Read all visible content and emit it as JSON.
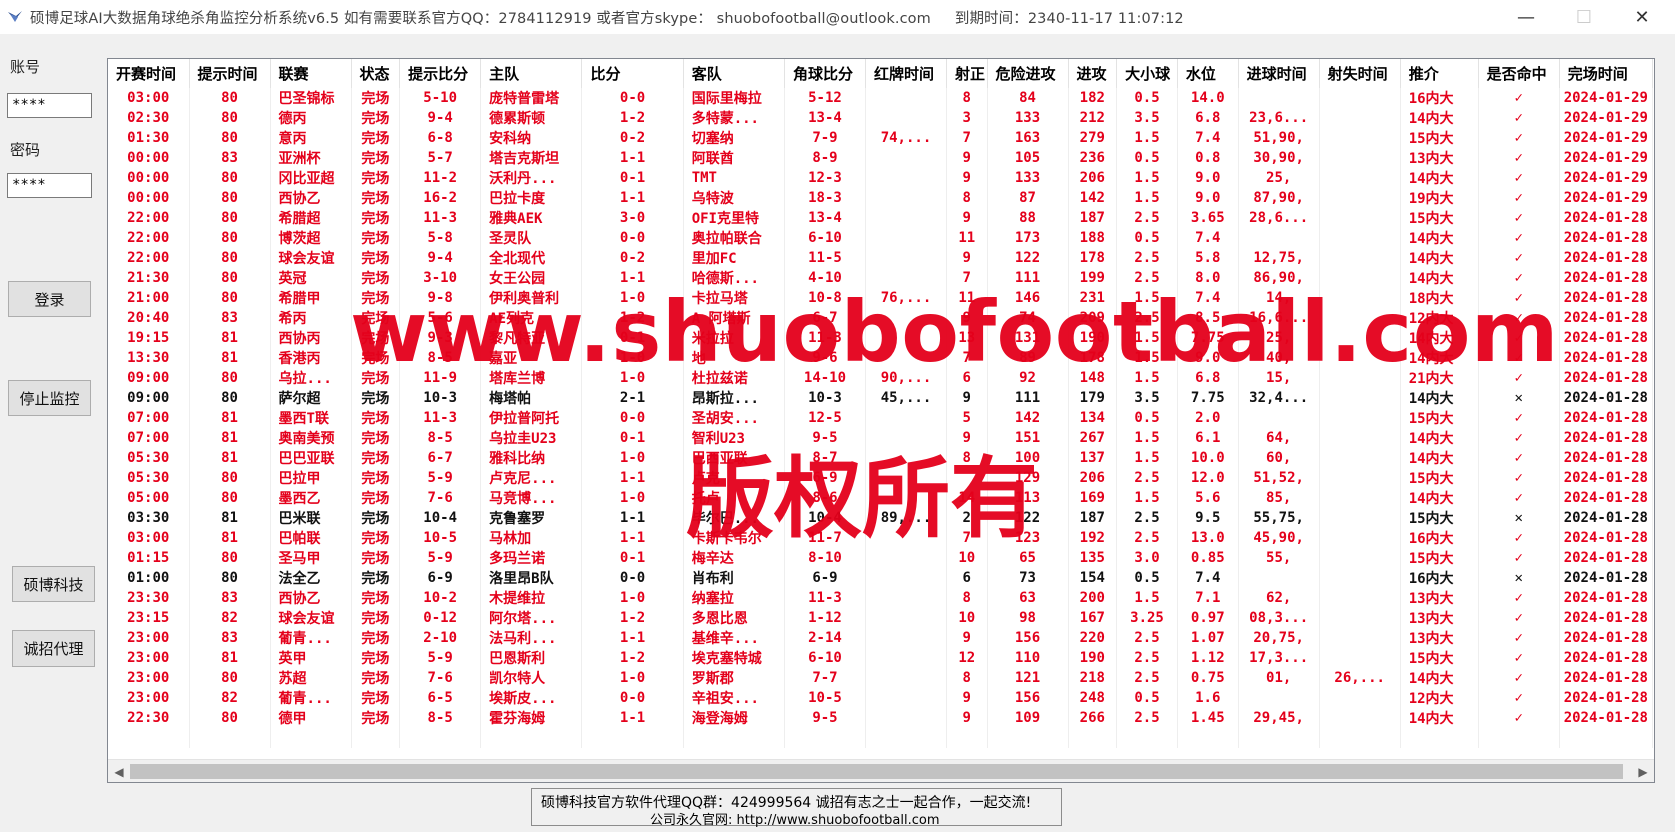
{
  "window": {
    "title": "硕博足球AI大数据角球绝杀角监控分析系统v6.5  如有需要联系官方QQ：2784112919 或者官方skype：  shuobofootball@outlook.com",
    "expire": "到期时间：2340-11-17 11:07:12",
    "minimize_glyph": "—",
    "maximize_glyph": "☐",
    "close_glyph": "✕"
  },
  "sidebar": {
    "account_label": "账号",
    "account_value": "****",
    "password_label": "密码",
    "password_value": "****",
    "login_button": "登录",
    "stop_button": "停止监控",
    "company_button": "硕博科技",
    "agent_button": "诚招代理"
  },
  "table": {
    "headers": [
      "开赛时间",
      "提示时间",
      "联赛",
      "状态",
      "提示比分",
      "主队",
      "比分",
      "客队",
      "角球比分",
      "红牌时间",
      "射正",
      "危险进攻",
      "进攻",
      "大小球",
      "水位",
      "进球时间",
      "射失时间",
      "推介",
      "是否命中",
      "完场时间"
    ],
    "rows": [
      {
        "c": [
          "03:00",
          "80",
          "巴圣锦标",
          "完场",
          "5-10",
          "庞特普雷塔",
          "0-0",
          "国际里梅拉",
          "5-12",
          "",
          "8",
          "84",
          "182",
          "0.5",
          "14.0",
          "",
          "",
          "16内大",
          "✓",
          "2024-01-29"
        ],
        "color": "red"
      },
      {
        "c": [
          "02:30",
          "80",
          "德丙",
          "完场",
          "9-4",
          "德累斯顿",
          "1-2",
          "多特蒙...",
          "13-4",
          "",
          "3",
          "133",
          "212",
          "3.5",
          "6.8",
          "23,6...",
          "",
          "14内大",
          "✓",
          "2024-01-29"
        ],
        "color": "red"
      },
      {
        "c": [
          "01:30",
          "80",
          "意丙",
          "完场",
          "6-8",
          "安科纳",
          "0-2",
          "切塞纳",
          "7-9",
          "74,...",
          "7",
          "163",
          "279",
          "1.5",
          "7.4",
          "51,90,",
          "",
          "15内大",
          "✓",
          "2024-01-29"
        ],
        "color": "red"
      },
      {
        "c": [
          "00:00",
          "83",
          "亚洲杯",
          "完场",
          "5-7",
          "塔吉克斯坦",
          "1-1",
          "阿联酋",
          "8-9",
          "",
          "9",
          "105",
          "236",
          "0.5",
          "0.8",
          "30,90,",
          "",
          "13内大",
          "✓",
          "2024-01-29"
        ],
        "color": "red"
      },
      {
        "c": [
          "00:00",
          "80",
          "冈比亚超",
          "完场",
          "11-2",
          "沃利丹...",
          "0-1",
          "TMT",
          "12-3",
          "",
          "9",
          "133",
          "206",
          "1.5",
          "9.0",
          "25,",
          "",
          "14内大",
          "✓",
          "2024-01-29"
        ],
        "color": "red"
      },
      {
        "c": [
          "00:00",
          "80",
          "西协乙",
          "完场",
          "16-2",
          "巴拉卡度",
          "1-1",
          "乌特波",
          "18-3",
          "",
          "8",
          "87",
          "142",
          "1.5",
          "9.0",
          "87,90,",
          "",
          "19内大",
          "✓",
          "2024-01-29"
        ],
        "color": "red"
      },
      {
        "c": [
          "22:00",
          "80",
          "希腊超",
          "完场",
          "11-3",
          "雅典AEK",
          "3-0",
          "OFI克里特",
          "13-4",
          "",
          "9",
          "88",
          "187",
          "2.5",
          "3.65",
          "28,6...",
          "",
          "15内大",
          "✓",
          "2024-01-28"
        ],
        "color": "red"
      },
      {
        "c": [
          "22:00",
          "80",
          "博茨超",
          "完场",
          "5-8",
          "圣灵队",
          "0-0",
          "奥拉帕联合",
          "6-10",
          "",
          "11",
          "173",
          "188",
          "0.5",
          "7.4",
          "",
          "",
          "14内大",
          "✓",
          "2024-01-28"
        ],
        "color": "red"
      },
      {
        "c": [
          "22:00",
          "80",
          "球会友谊",
          "完场",
          "9-4",
          "全北现代",
          "0-2",
          "里加FC",
          "11-5",
          "",
          "9",
          "122",
          "178",
          "2.5",
          "5.8",
          "12,75,",
          "",
          "14内大",
          "✓",
          "2024-01-28"
        ],
        "color": "red"
      },
      {
        "c": [
          "21:30",
          "80",
          "英冠",
          "完场",
          "3-10",
          "女王公园",
          "1-1",
          "哈德斯...",
          "4-10",
          "",
          "7",
          "111",
          "199",
          "2.5",
          "8.0",
          "86,90,",
          "",
          "14内大",
          "✓",
          "2024-01-28"
        ],
        "color": "red"
      },
      {
        "c": [
          "21:00",
          "80",
          "希腊甲",
          "完场",
          "9-8",
          "伊利奥普利",
          "1-0",
          "卡拉马塔",
          "10-8",
          "76,...",
          "11",
          "146",
          "231",
          "1.5",
          "7.4",
          "14,",
          "",
          "18内大",
          "✓",
          "2024-01-28"
        ],
        "color": "red"
      },
      {
        "c": [
          "20:40",
          "83",
          "希丙",
          "完场",
          "5-6",
          "AE列克",
          "1-2",
          "A 阿塔斯",
          "6-7",
          "",
          "9",
          "74",
          "209",
          "2.5",
          "8.5",
          "16,6...",
          "",
          "12内大",
          "✓",
          "2024-01-28"
        ],
        "color": "red"
      },
      {
        "c": [
          "19:15",
          "81",
          "西协丙",
          "完场",
          "9-3",
          "黎凡特亚",
          "0-1",
          "米拉拉",
          "11-3",
          "",
          "13",
          "131",
          "190",
          "1.5",
          "7.75",
          "25,",
          "",
          "14内大",
          "✓",
          "2024-01-28"
        ],
        "color": "red"
      },
      {
        "c": [
          "13:30",
          "81",
          "香港丙",
          "完场",
          "8-5",
          "嘉亚",
          "1-0",
          "地",
          "9-6",
          "",
          "7",
          "89",
          "178",
          "1.5",
          "9.0",
          "40,",
          "",
          "14内大",
          "✓",
          "2024-01-28"
        ],
        "color": "red"
      },
      {
        "c": [
          "09:00",
          "80",
          "乌拉...",
          "完场",
          "11-9",
          "塔库兰博",
          "1-0",
          "杜拉兹诺",
          "14-10",
          "90,...",
          "6",
          "92",
          "148",
          "1.5",
          "6.8",
          "15,",
          "",
          "21内大",
          "✓",
          "2024-01-28"
        ],
        "color": "red"
      },
      {
        "c": [
          "09:00",
          "80",
          "萨尔超",
          "完场",
          "10-3",
          "梅塔帕",
          "2-1",
          "昂斯拉...",
          "10-3",
          "45,...",
          "9",
          "111",
          "179",
          "3.5",
          "7.75",
          "32,4...",
          "",
          "14内大",
          "✕",
          "2024-01-28"
        ],
        "color": "black"
      },
      {
        "c": [
          "07:00",
          "81",
          "墨西T联",
          "完场",
          "11-3",
          "伊拉普阿托",
          "0-0",
          "圣胡安...",
          "12-5",
          "",
          "5",
          "142",
          "134",
          "0.5",
          "2.0",
          "",
          "",
          "15内大",
          "✓",
          "2024-01-28"
        ],
        "color": "red"
      },
      {
        "c": [
          "07:00",
          "81",
          "奥南美预",
          "完场",
          "8-5",
          "乌拉圭U23",
          "0-1",
          "智利U23",
          "9-5",
          "",
          "9",
          "151",
          "267",
          "1.5",
          "6.1",
          "64,",
          "",
          "14内大",
          "✓",
          "2024-01-28"
        ],
        "color": "red"
      },
      {
        "c": [
          "05:30",
          "81",
          "巴巴亚联",
          "完场",
          "6-7",
          "雅科比纳",
          "1-0",
          "巴西亚联",
          "8-7",
          "",
          "8",
          "100",
          "137",
          "1.5",
          "10.0",
          "60,",
          "",
          "14内大",
          "✓",
          "2024-01-28"
        ],
        "color": "red"
      },
      {
        "c": [
          "05:30",
          "80",
          "巴拉甲",
          "完场",
          "5-9",
          "卢克尼...",
          "1-1",
          "卢克",
          "6-9",
          "",
          "",
          "129",
          "206",
          "2.5",
          "12.0",
          "51,52,",
          "",
          "15内大",
          "✓",
          "2024-01-28"
        ],
        "color": "red"
      },
      {
        "c": [
          "05:00",
          "80",
          "墨西乙",
          "完场",
          "7-6",
          "马竞博...",
          "1-0",
          "托卢",
          "8-6",
          "",
          "14",
          "113",
          "169",
          "1.5",
          "5.6",
          "85,",
          "",
          "14内大",
          "✓",
          "2024-01-28"
        ],
        "color": "red"
      },
      {
        "c": [
          "03:30",
          "81",
          "巴米联",
          "完场",
          "10-4",
          "克鲁塞罗",
          "1-1",
          "毕尔巴...",
          "10-4",
          "89,...",
          "2",
          "122",
          "187",
          "2.5",
          "9.5",
          "55,75,",
          "",
          "15内大",
          "✕",
          "2024-01-28"
        ],
        "color": "black"
      },
      {
        "c": [
          "03:00",
          "81",
          "巴帕联",
          "完场",
          "10-5",
          "马林加",
          "1-1",
          "卡斯卡韦尔",
          "11-7",
          "",
          "7",
          "123",
          "192",
          "2.5",
          "13.0",
          "45,90,",
          "",
          "16内大",
          "✓",
          "2024-01-28"
        ],
        "color": "red"
      },
      {
        "c": [
          "01:15",
          "80",
          "圣马甲",
          "完场",
          "5-9",
          "多玛兰诺",
          "0-1",
          "梅辛达",
          "8-10",
          "",
          "10",
          "65",
          "135",
          "3.0",
          "0.85",
          "55,",
          "",
          "15内大",
          "✓",
          "2024-01-28"
        ],
        "color": "red"
      },
      {
        "c": [
          "01:00",
          "80",
          "法全乙",
          "完场",
          "6-9",
          "洛里昂B队",
          "0-0",
          "肖布利",
          "6-9",
          "",
          "6",
          "73",
          "154",
          "0.5",
          "7.4",
          "",
          "",
          "16内大",
          "✕",
          "2024-01-28"
        ],
        "color": "black"
      },
      {
        "c": [
          "23:30",
          "83",
          "西协乙",
          "完场",
          "10-2",
          "木提维拉",
          "1-0",
          "纳塞拉",
          "11-3",
          "",
          "8",
          "63",
          "200",
          "1.5",
          "7.1",
          "62,",
          "",
          "13内大",
          "✓",
          "2024-01-28"
        ],
        "color": "red"
      },
      {
        "c": [
          "23:15",
          "82",
          "球会友谊",
          "完场",
          "0-12",
          "阿尔塔...",
          "1-2",
          "多恩比恩",
          "1-12",
          "",
          "10",
          "98",
          "167",
          "3.25",
          "0.97",
          "08,3...",
          "",
          "13内大",
          "✓",
          "2024-01-28"
        ],
        "color": "red"
      },
      {
        "c": [
          "23:00",
          "83",
          "葡青...",
          "完场",
          "2-10",
          "法马利...",
          "1-1",
          "基维辛...",
          "2-14",
          "",
          "9",
          "156",
          "220",
          "2.5",
          "1.07",
          "20,75,",
          "",
          "13内大",
          "✓",
          "2024-01-28"
        ],
        "color": "red"
      },
      {
        "c": [
          "23:00",
          "81",
          "英甲",
          "完场",
          "5-9",
          "巴恩斯利",
          "1-2",
          "埃克塞特城",
          "6-10",
          "",
          "12",
          "110",
          "190",
          "2.5",
          "1.12",
          "17,3...",
          "",
          "15内大",
          "✓",
          "2024-01-28"
        ],
        "color": "red"
      },
      {
        "c": [
          "23:00",
          "80",
          "苏超",
          "完场",
          "7-6",
          "凯尔特人",
          "1-0",
          "罗斯郡",
          "7-7",
          "",
          "8",
          "121",
          "218",
          "2.5",
          "0.75",
          "01,",
          "26,...",
          "14内大",
          "✓",
          "2024-01-28"
        ],
        "color": "red"
      },
      {
        "c": [
          "23:00",
          "82",
          "葡青...",
          "完场",
          "6-5",
          "埃斯皮...",
          "0-0",
          "辛祖安...",
          "10-5",
          "",
          "9",
          "156",
          "248",
          "0.5",
          "1.6",
          "",
          "",
          "12内大",
          "✓",
          "2024-01-28"
        ],
        "color": "red"
      },
      {
        "c": [
          "22:30",
          "80",
          "德甲",
          "完场",
          "8-5",
          "霍芬海姆",
          "1-1",
          "海登海姆",
          "9-5",
          "",
          "9",
          "109",
          "266",
          "2.5",
          "1.45",
          "29,45,",
          "",
          "14内大",
          "✓",
          "2024-01-28"
        ],
        "color": "red"
      }
    ]
  },
  "footer": {
    "line1": "硕博科技官方软件代理QQ群：424999564 诚招有志之士一起合作，一起交流!",
    "line2": "公司永久官网: http://www.shuobofootball.com"
  },
  "watermark": {
    "url": "www.shuobofootball.com",
    "rights": "版权所有"
  },
  "colors": {
    "hit_red": "#e4001b",
    "miss_black": "#111111",
    "window_bg": "#f0f0f0"
  }
}
